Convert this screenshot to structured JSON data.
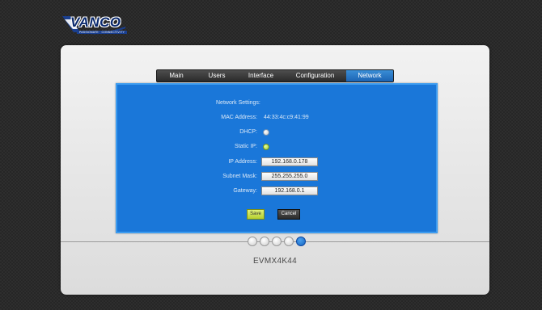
{
  "brand": {
    "logo_text": "VANCO",
    "tagline": "PASSIONATE · CONNECTIVITY",
    "colors": {
      "brand_blue": "#0b2a6e",
      "accent": "#1a77d9"
    }
  },
  "nav": {
    "tabs": [
      {
        "label": "Main",
        "active": false
      },
      {
        "label": "Users",
        "active": false
      },
      {
        "label": "Interface",
        "active": false
      },
      {
        "label": "Configuration",
        "active": false
      },
      {
        "label": "Network",
        "active": true
      }
    ]
  },
  "network": {
    "section_title": "Network Settings:",
    "mac_label": "MAC Address:",
    "mac_value": "44:33:4c:c9:41:99",
    "dhcp_label": "DHCP:",
    "dhcp_selected": false,
    "static_label": "Static IP:",
    "static_selected": true,
    "ip_label": "IP Address:",
    "ip_value": "192.168.0.178",
    "subnet_label": "Subnet Mask:",
    "subnet_value": "255.255.255.0",
    "gateway_label": "Gateway:",
    "gateway_value": "192.168.0.1",
    "save_label": "Save",
    "cancel_label": "Cancel"
  },
  "pager": {
    "count": 5,
    "active_index": 4
  },
  "device": {
    "model": "EVMX4K44"
  }
}
